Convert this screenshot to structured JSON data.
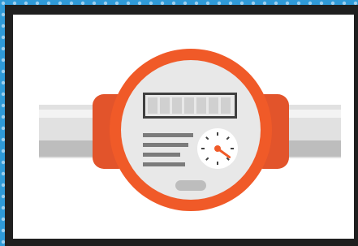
{
  "illustration": {
    "subject": "water-meter",
    "colors": {
      "background_pattern": "#2f9ad8",
      "dot": "#9fd0ef",
      "frame": "#1f1f1f",
      "panel": "#ffffff",
      "pipe_light": "#e1e1e1",
      "pipe_dark": "#bdbdbd",
      "pipe_highlight": "#f3f3f3",
      "collar": "#e2542b",
      "ring": "#f05a28",
      "face": "#e8e8e8",
      "counter_border": "#3f3f3f",
      "counter_digit": "#d0d0d0",
      "text_lines": "#7b7b7b",
      "dial_face": "#ffffff",
      "needle": "#f05a28",
      "button": "#bdbdbd"
    },
    "counter_digit_count": 7,
    "gauge_reading": 0.35,
    "icons": [
      "counter-display-icon",
      "dial-gauge-icon",
      "info-lines-icon"
    ]
  }
}
